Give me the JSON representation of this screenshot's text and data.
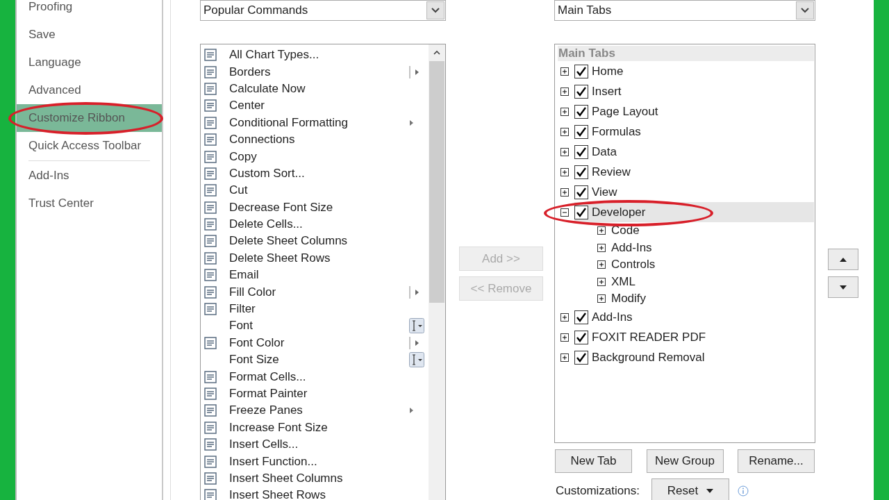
{
  "sidebar": {
    "items": [
      {
        "label": "Proofing",
        "selected": false,
        "circled": false
      },
      {
        "label": "Save",
        "selected": false,
        "circled": false
      },
      {
        "label": "Language",
        "selected": false,
        "circled": false
      },
      {
        "label": "Advanced",
        "selected": false,
        "circled": false
      },
      {
        "label": "Customize Ribbon",
        "selected": true,
        "circled": true
      },
      {
        "label": "Quick Access Toolbar",
        "selected": false,
        "circled": false,
        "separator_after": true
      },
      {
        "label": "Add-Ins",
        "selected": false,
        "circled": false
      },
      {
        "label": "Trust Center",
        "selected": false,
        "circled": false
      }
    ]
  },
  "commands": {
    "dropdown": "Popular Commands",
    "items": [
      {
        "label": "All Chart Types...",
        "icon": true,
        "kind": "plain"
      },
      {
        "label": "Borders",
        "icon": true,
        "kind": "split"
      },
      {
        "label": "Calculate Now",
        "icon": true,
        "kind": "plain"
      },
      {
        "label": "Center",
        "icon": true,
        "kind": "plain"
      },
      {
        "label": "Conditional Formatting",
        "icon": true,
        "kind": "submenu"
      },
      {
        "label": "Connections",
        "icon": true,
        "kind": "plain"
      },
      {
        "label": "Copy",
        "icon": true,
        "kind": "plain"
      },
      {
        "label": "Custom Sort...",
        "icon": true,
        "kind": "plain"
      },
      {
        "label": "Cut",
        "icon": true,
        "kind": "plain"
      },
      {
        "label": "Decrease Font Size",
        "icon": true,
        "kind": "plain"
      },
      {
        "label": "Delete Cells...",
        "icon": true,
        "kind": "plain"
      },
      {
        "label": "Delete Sheet Columns",
        "icon": true,
        "kind": "plain"
      },
      {
        "label": "Delete Sheet Rows",
        "icon": true,
        "kind": "plain"
      },
      {
        "label": "Email",
        "icon": true,
        "kind": "plain"
      },
      {
        "label": "Fill Color",
        "icon": true,
        "kind": "split"
      },
      {
        "label": "Filter",
        "icon": true,
        "kind": "plain"
      },
      {
        "label": "Font",
        "icon": false,
        "kind": "textbox"
      },
      {
        "label": "Font Color",
        "icon": true,
        "kind": "split"
      },
      {
        "label": "Font Size",
        "icon": false,
        "kind": "textbox"
      },
      {
        "label": "Format Cells...",
        "icon": true,
        "kind": "plain"
      },
      {
        "label": "Format Painter",
        "icon": true,
        "kind": "plain"
      },
      {
        "label": "Freeze Panes",
        "icon": true,
        "kind": "submenu"
      },
      {
        "label": "Increase Font Size",
        "icon": true,
        "kind": "plain"
      },
      {
        "label": "Insert Cells...",
        "icon": true,
        "kind": "plain"
      },
      {
        "label": "Insert Function...",
        "icon": true,
        "kind": "plain"
      },
      {
        "label": "Insert Sheet Columns",
        "icon": true,
        "kind": "plain"
      },
      {
        "label": "Insert Sheet Rows",
        "icon": true,
        "kind": "plain"
      }
    ]
  },
  "add_button": {
    "label": "Add >>",
    "disabled": true
  },
  "remove_button": {
    "label": "<< Remove",
    "disabled": true
  },
  "tabs": {
    "dropdown": "Main Tabs",
    "header": "Main Tabs",
    "items": [
      {
        "label": "Home",
        "checked": true,
        "expanded": false,
        "selected": false,
        "circled": false
      },
      {
        "label": "Insert",
        "checked": true,
        "expanded": false,
        "selected": false,
        "circled": false
      },
      {
        "label": "Page Layout",
        "checked": true,
        "expanded": false,
        "selected": false,
        "circled": false
      },
      {
        "label": "Formulas",
        "checked": true,
        "expanded": false,
        "selected": false,
        "circled": false
      },
      {
        "label": "Data",
        "checked": true,
        "expanded": false,
        "selected": false,
        "circled": false
      },
      {
        "label": "Review",
        "checked": true,
        "expanded": false,
        "selected": false,
        "circled": false
      },
      {
        "label": "View",
        "checked": true,
        "expanded": false,
        "selected": false,
        "circled": false
      },
      {
        "label": "Developer",
        "checked": true,
        "expanded": true,
        "selected": true,
        "circled": true,
        "children": [
          {
            "label": "Code",
            "expanded": false
          },
          {
            "label": "Add-Ins",
            "expanded": false
          },
          {
            "label": "Controls",
            "expanded": false
          },
          {
            "label": "XML",
            "expanded": false
          },
          {
            "label": "Modify",
            "expanded": false
          }
        ]
      },
      {
        "label": "Add-Ins",
        "checked": true,
        "expanded": false,
        "selected": false,
        "circled": false
      },
      {
        "label": "FOXIT READER PDF",
        "checked": true,
        "expanded": false,
        "selected": false,
        "circled": false
      },
      {
        "label": "Background Removal",
        "checked": true,
        "expanded": false,
        "selected": false,
        "circled": false
      }
    ]
  },
  "tab_buttons": [
    "New Tab",
    "New Group",
    "Rename..."
  ],
  "customizations": {
    "label": "Customizations:",
    "button": "Reset"
  }
}
